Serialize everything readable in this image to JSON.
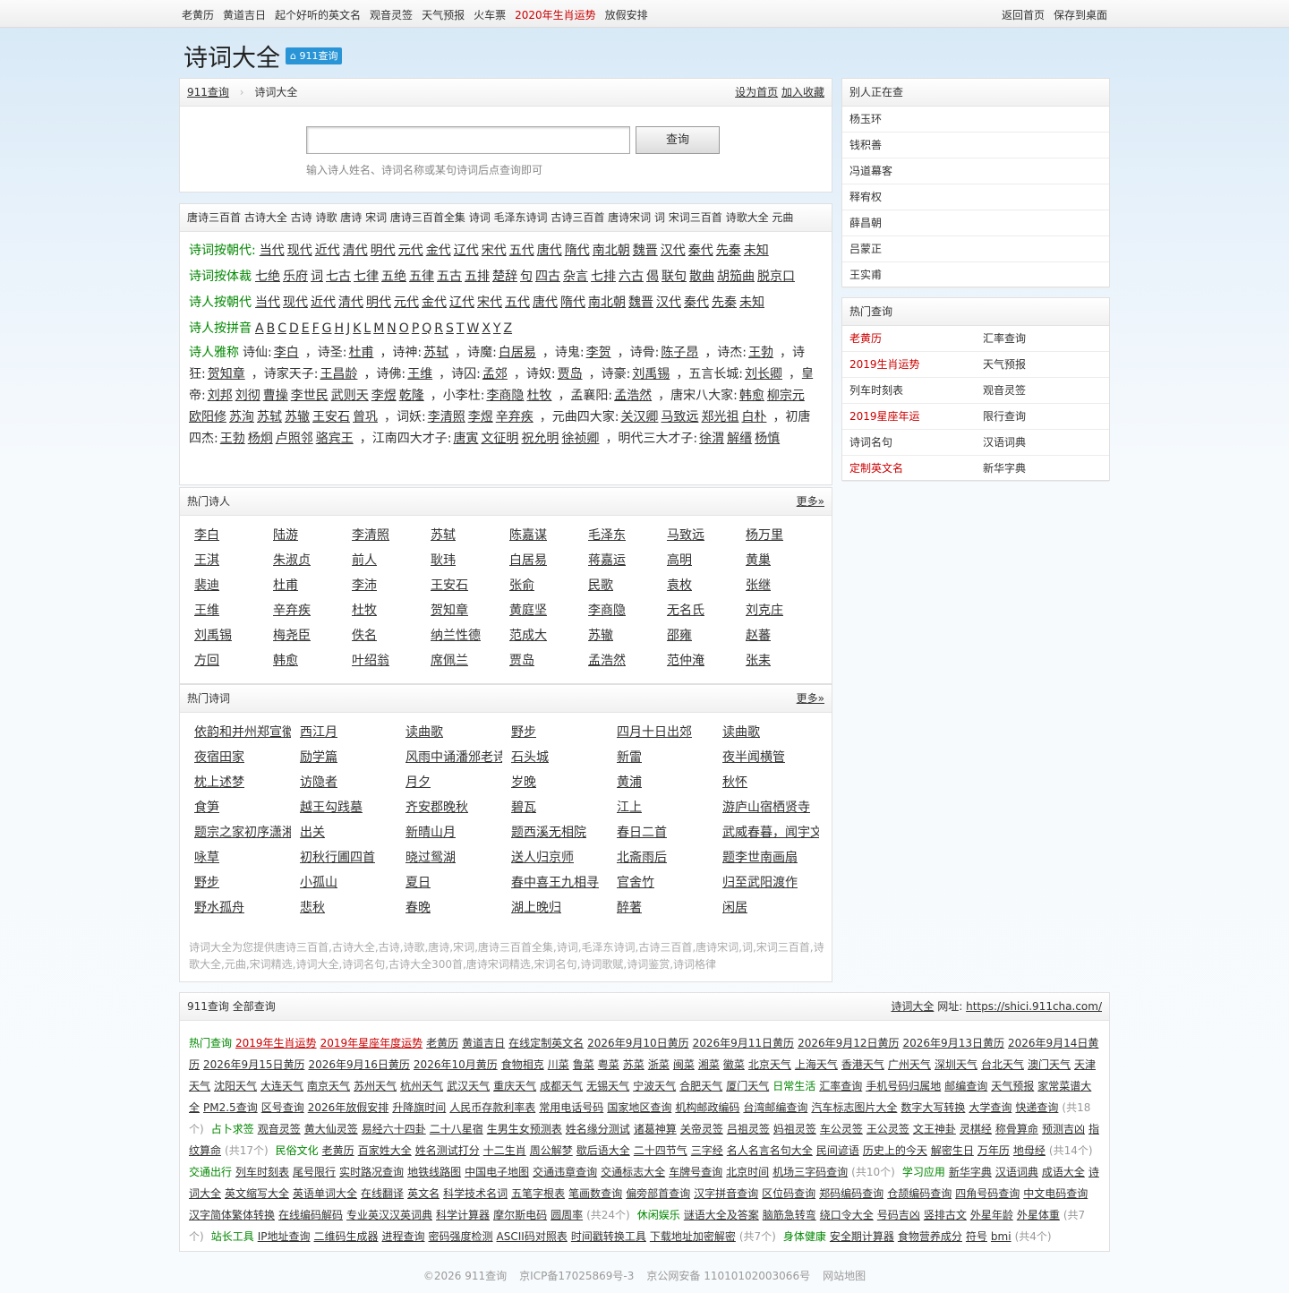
{
  "topnav": {
    "links": [
      "老黄历",
      "黄道吉日",
      "起个好听的英文名",
      "观音灵签",
      "天气预报",
      "火车票",
      "2020年生肖运势",
      "放假安排"
    ],
    "right": [
      "返回首页",
      "保存到桌面"
    ]
  },
  "page": {
    "title": "诗词大全",
    "badge": "911查询"
  },
  "breadcrumb": {
    "home": "911查询",
    "current": "诗词大全",
    "set_home": "设为首页",
    "favorite": "加入收藏"
  },
  "search": {
    "value": "",
    "button": "查询",
    "hint": "输入诗人姓名、诗词名称或某句诗词后点查询即可"
  },
  "keywords": "唐诗三百首 古诗大全 古诗 诗歌 唐诗 宋词 唐诗三百首全集 诗词 毛泽东诗词 古诗三百首 唐诗宋词 词 宋词三百首 诗歌大全 元曲",
  "categories": [
    {
      "label": "诗词按朝代:",
      "items": [
        "当代",
        "现代",
        "近代",
        "清代",
        "明代",
        "元代",
        "金代",
        "辽代",
        "宋代",
        "五代",
        "唐代",
        "隋代",
        "南北朝",
        "魏晋",
        "汉代",
        "秦代",
        "先秦",
        "未知"
      ]
    },
    {
      "label": "诗词按体裁",
      "items": [
        "七绝",
        "乐府",
        "词",
        "七古",
        "七律",
        "五绝",
        "五律",
        "五古",
        "五排",
        "楚辞",
        "句",
        "四古",
        "杂言",
        "七排",
        "六古",
        "偈",
        "联句",
        "散曲",
        "胡笳曲",
        "脱京口"
      ]
    },
    {
      "label": "诗人按朝代",
      "items": [
        "当代",
        "现代",
        "近代",
        "清代",
        "明代",
        "元代",
        "金代",
        "辽代",
        "宋代",
        "五代",
        "唐代",
        "隋代",
        "南北朝",
        "魏晋",
        "汉代",
        "秦代",
        "先秦",
        "未知"
      ]
    },
    {
      "label": "诗人按拼音",
      "items": [
        "A",
        "B",
        "C",
        "D",
        "E",
        "F",
        "G",
        "H",
        "J",
        "K",
        "L",
        "M",
        "N",
        "O",
        "P",
        "Q",
        "R",
        "S",
        "T",
        "W",
        "X",
        "Y",
        "Z"
      ]
    }
  ],
  "aliases": {
    "label": "诗人雅称",
    "segments": [
      {
        "t": "诗仙:",
        "p": [
          "李白"
        ]
      },
      {
        "t": "，诗圣:",
        "p": [
          "杜甫"
        ]
      },
      {
        "t": "，诗神:",
        "p": [
          "苏轼"
        ]
      },
      {
        "t": "，诗魔:",
        "p": [
          "白居易"
        ]
      },
      {
        "t": "，诗鬼:",
        "p": [
          "李贺"
        ]
      },
      {
        "t": "，诗骨:",
        "p": [
          "陈子昂"
        ]
      },
      {
        "t": "，诗杰:",
        "p": [
          "王勃"
        ]
      },
      {
        "t": "，诗狂:",
        "p": [
          "贺知章"
        ]
      },
      {
        "t": "，诗家天子:",
        "p": [
          "王昌龄"
        ]
      },
      {
        "t": "，诗佛:",
        "p": [
          "王维"
        ]
      },
      {
        "t": "，诗囚:",
        "p": [
          "孟郊"
        ]
      },
      {
        "t": "，诗奴:",
        "p": [
          "贾岛"
        ]
      },
      {
        "t": "，诗豪:",
        "p": [
          "刘禹锡"
        ]
      },
      {
        "t": "，五言长城:",
        "p": [
          "刘长卿"
        ]
      },
      {
        "t": "，皇帝:",
        "p": [
          "刘邦",
          "刘彻",
          "曹操",
          "李世民",
          "武则天",
          "李煜",
          "乾隆"
        ]
      },
      {
        "t": "，小李杜:",
        "p": [
          "李商隐",
          "杜牧"
        ]
      },
      {
        "t": "，孟襄阳:",
        "p": [
          "孟浩然"
        ]
      },
      {
        "t": "，唐宋八大家:",
        "p": [
          "韩愈",
          "柳宗元",
          "欧阳修",
          "苏洵",
          "苏轼",
          "苏辙",
          "王安石",
          "曾巩"
        ]
      },
      {
        "t": "，词妖:",
        "p": [
          "李清照",
          "李煜",
          "辛弃疾"
        ]
      },
      {
        "t": "，元曲四大家:",
        "p": [
          "关汉卿",
          "马致远",
          "郑光祖",
          "白朴"
        ]
      },
      {
        "t": "，初唐四杰:",
        "p": [
          "王勃",
          "杨炯",
          "卢照邻",
          "骆宾王"
        ]
      },
      {
        "t": "，江南四大才子:",
        "p": [
          "唐寅",
          "文征明",
          "祝允明",
          "徐祯卿"
        ]
      },
      {
        "t": "，明代三大才子:",
        "p": [
          "徐渭",
          "解缙",
          "杨慎"
        ]
      }
    ]
  },
  "hot_poets": {
    "title": "热门诗人",
    "more": "更多»",
    "items": [
      "李白",
      "陆游",
      "李清照",
      "苏轼",
      "陈嘉谋",
      "毛泽东",
      "马致远",
      "杨万里",
      "王淇",
      "朱淑贞",
      "前人",
      "耿玮",
      "白居易",
      "蒋嘉运",
      "高明",
      "黄巢",
      "裴迪",
      "杜甫",
      "李沛",
      "王安石",
      "张俞",
      "民歌",
      "袁枚",
      "张继",
      "王维",
      "辛弃疾",
      "杜牧",
      "贺知章",
      "黄庭坚",
      "李商隐",
      "无名氏",
      "刘克庄",
      "刘禹锡",
      "梅尧臣",
      "佚名",
      "纳兰性德",
      "范成大",
      "苏辙",
      "邵雍",
      "赵蕃",
      "方回",
      "韩愈",
      "叶绍翁",
      "席佩兰",
      "贾岛",
      "孟浩然",
      "范仲淹",
      "张耒"
    ]
  },
  "hot_poems": {
    "title": "热门诗词",
    "more": "更多»",
    "items": [
      "依韵和并州郑宣徽",
      "西江月",
      "读曲歌",
      "野步",
      "四月十日出郊",
      "读曲歌",
      "夜宿田家",
      "励学篇",
      "风雨中诵潘邠老诗",
      "石头城",
      "新雷",
      "夜半闻横管",
      "枕上述梦",
      "访隐者",
      "月夕",
      "岁晚",
      "黄浦",
      "秋怀",
      "食笋",
      "越王勾践墓",
      "齐安郡晚秋",
      "碧瓦",
      "江上",
      "游庐山宿栖贤寺",
      "题宗之家初序潇湘",
      "出关",
      "新晴山月",
      "题西溪无相院",
      "春日二首",
      "武威春暮，闻宇文",
      "咏草",
      "初秋行圃四首",
      "晓过鸳湖",
      "送人归京师",
      "北斋雨后",
      "题李世南画扇",
      "野步",
      "小孤山",
      "夏日",
      "春中喜王九相寻",
      "官舍竹",
      "归至武阳渡作",
      "野水孤舟",
      "悲秋",
      "春晚",
      "湖上晚归",
      "醉著",
      "闲居"
    ],
    "desc": "诗词大全为您提供唐诗三百首,古诗大全,古诗,诗歌,唐诗,宋词,唐诗三百首全集,诗词,毛泽东诗词,古诗三百首,唐诗宋词,词,宋词三百首,诗歌大全,元曲,宋词精选,诗词大全,诗词名句,古诗大全300首,唐诗宋词精选,宋词名句,诗词歌赋,诗词鉴赏,诗词格律"
  },
  "side_recent": {
    "title": "别人正在查",
    "items": [
      "杨玉环",
      "钱积善",
      "冯道幕客",
      "释宥权",
      "薛昌朝",
      "吕蒙正",
      "王实甫"
    ]
  },
  "side_hot": {
    "title": "热门查询",
    "rows": [
      [
        "老黄历",
        "汇率查询"
      ],
      [
        "2019生肖运势",
        "天气预报"
      ],
      [
        "列车时刻表",
        "观音灵签"
      ],
      [
        "2019星座年运",
        "限行查询"
      ],
      [
        "诗词名句",
        "汉语词典"
      ],
      [
        "定制英文名",
        "新华字典"
      ]
    ]
  },
  "all_queries": {
    "title": "911查询 全部查询",
    "site": "诗词大全",
    "url_label": "网址:",
    "url": "https://shici.911cha.com/",
    "groups": [
      {
        "label": "热门查询",
        "red": [
          "2019年生肖运势",
          "2019年星座年度运势"
        ],
        "items": [
          "老黄历",
          "黄道吉日",
          "在线定制英文名",
          "2026年9月10日黄历",
          "2026年9月11日黄历",
          "2026年9月12日黄历",
          "2026年9月13日黄历",
          "2026年9月14日黄历",
          "2026年9月15日黄历",
          "2026年9月16日黄历",
          "2026年10月黄历",
          "食物相克",
          "川菜",
          "鲁菜",
          "粤菜",
          "苏菜",
          "浙菜",
          "闽菜",
          "湘菜",
          "徽菜",
          "北京天气",
          "上海天气",
          "香港天气",
          "广州天气",
          "深圳天气",
          "台北天气",
          "澳门天气",
          "天津天气",
          "沈阳天气",
          "大连天气",
          "南京天气",
          "苏州天气",
          "杭州天气",
          "武汉天气",
          "重庆天气",
          "成都天气",
          "无锡天气",
          "宁波天气",
          "合肥天气",
          "厦门天气"
        ]
      },
      {
        "label": "日常生活",
        "items": [
          "汇率查询",
          "手机号码归属地",
          "邮编查询",
          "天气预报",
          "家常菜谱大全",
          "PM2.5查询",
          "区号查询",
          "2026年放假安排",
          "升降旗时间",
          "人民币存款利率表",
          "常用电话号码",
          "国家地区查询",
          "机构邮政编码",
          "台湾邮编查询",
          "汽车标志图片大全",
          "数字大写转换",
          "大学查询",
          "快递查询"
        ],
        "count": "(共18个)"
      },
      {
        "label": "占卜求签",
        "items": [
          "观音灵签",
          "黄大仙灵签",
          "易经六十四卦",
          "二十八星宿",
          "生男生女预测表",
          "姓名缘分测试",
          "诸葛神算",
          "关帝灵签",
          "吕祖灵签",
          "妈祖灵签",
          "车公灵签",
          "王公灵签",
          "文王神卦",
          "灵棋经",
          "称骨算命",
          "预测吉凶",
          "指纹算命"
        ],
        "count": "(共17个)"
      },
      {
        "label": "民俗文化",
        "items": [
          "老黄历",
          "百家姓大全",
          "姓名测试打分",
          "十二生肖",
          "周公解梦",
          "歇后语大全",
          "二十四节气",
          "三字经",
          "名人名言名句大全",
          "民间谚语",
          "历史上的今天",
          "解密生日",
          "万年历",
          "地母经"
        ],
        "count": "(共14个)"
      },
      {
        "label": "交通出行",
        "items": [
          "列车时刻表",
          "尾号限行",
          "实时路况查询",
          "地铁线路图",
          "中国电子地图",
          "交通违章查询",
          "交通标志大全",
          "车牌号查询",
          "北京时间",
          "机场三字码查询"
        ],
        "count": "(共10个)"
      },
      {
        "label": "学习应用",
        "items": [
          "新华字典",
          "汉语词典",
          "成语大全",
          "诗词大全",
          "英文缩写大全",
          "英语单词大全",
          "在线翻译",
          "英文名",
          "科学技术名词",
          "五笔字根表",
          "笔画数查询",
          "偏旁部首查询",
          "汉字拼音查询",
          "区位码查询",
          "郑码编码查询",
          "仓颉编码查询",
          "四角号码查询",
          "中文电码查询",
          "汉字简体繁体转换",
          "在线编码解码",
          "专业英汉汉英词典",
          "科学计算器",
          "摩尔斯电码",
          "圆周率"
        ],
        "count": "(共24个)"
      },
      {
        "label": "休闲娱乐",
        "items": [
          "谜语大全及答案",
          "脑筋急转弯",
          "绕口令大全",
          "号码吉凶",
          "竖排古文",
          "外星年龄",
          "外星体重"
        ],
        "count": "(共7个)"
      },
      {
        "label": "站长工具",
        "items": [
          "IP地址查询",
          "二维码生成器",
          "进程查询",
          "密码强度检测",
          "ASCII码对照表",
          "时间戳转换工具",
          "下载地址加密解密"
        ],
        "count": "(共7个)"
      },
      {
        "label": "身体健康",
        "items": [
          "安全期计算器",
          "食物营养成分",
          "符号",
          "bmi"
        ],
        "count": "(共4个)"
      }
    ]
  },
  "footer": [
    "©2026 911查询",
    "京ICP备17025869号-3",
    "京公网安备 11010102003066号",
    "网站地图"
  ]
}
